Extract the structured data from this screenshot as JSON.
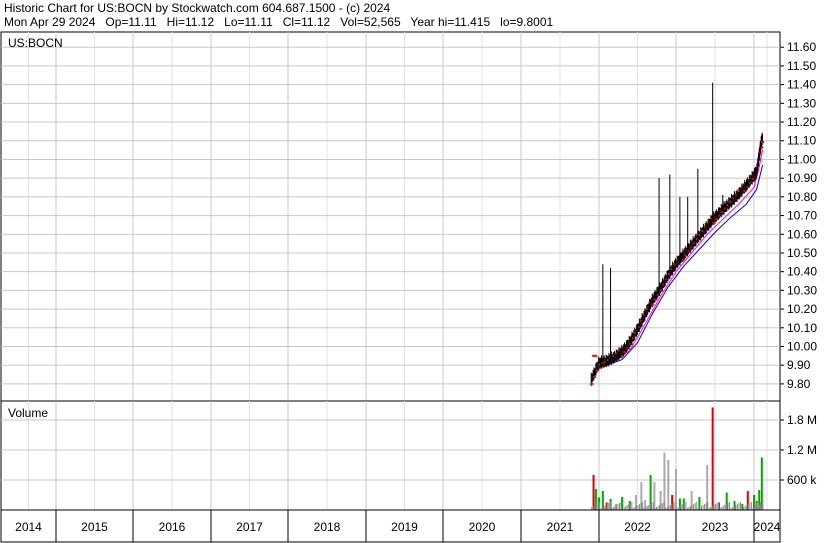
{
  "header": {
    "line1": "Historic Chart for US:BOCN by Stockwatch.com 604.687.1500 - (c) 2024",
    "line2": "Mon Apr 29 2024   Op=11.11   Hi=11.12   Lo=11.11   Cl=11.12   Vol=52,565   Year hi=11.415   lo=9.8001"
  },
  "chart_data": [
    {
      "type": "line",
      "title": "US:BOCN",
      "ylim": [
        9.73,
        11.66
      ],
      "ytick_labels": [
        "11.60",
        "11.50",
        "11.40",
        "11.30",
        "11.20",
        "11.10",
        "11.00",
        "10.90",
        "10.80",
        "10.70",
        "10.60",
        "10.50",
        "10.40",
        "10.30",
        "10.20",
        "10.10",
        "10.00",
        "9.90",
        "9.80"
      ],
      "yticks": [
        11.6,
        11.5,
        11.4,
        11.3,
        11.2,
        11.1,
        11.0,
        10.9,
        10.8,
        10.7,
        10.6,
        10.5,
        10.4,
        10.3,
        10.2,
        10.1,
        10.0,
        9.9,
        9.8
      ],
      "x_axis_years": [
        "2014",
        "2015",
        "2016",
        "2017",
        "2018",
        "2019",
        "2020",
        "2021",
        "2022",
        "2023",
        "2024"
      ],
      "grid": true,
      "series": [
        {
          "role": "price",
          "color": "#000000",
          "x": [
            2021.9,
            2022.0,
            2022.1,
            2022.2,
            2022.3,
            2022.4,
            2022.5,
            2022.6,
            2022.7,
            2022.8,
            2022.9,
            2023.0,
            2023.1,
            2023.2,
            2023.3,
            2023.4,
            2023.5,
            2023.6,
            2023.7,
            2023.8,
            2023.9,
            2024.0,
            2024.1,
            2024.2,
            2024.27,
            2024.33
          ],
          "y": [
            9.82,
            9.91,
            9.92,
            9.94,
            9.97,
            10.02,
            10.09,
            10.17,
            10.25,
            10.31,
            10.38,
            10.44,
            10.49,
            10.54,
            10.59,
            10.64,
            10.69,
            10.73,
            10.77,
            10.81,
            10.86,
            10.91,
            10.93,
            11.02,
            11.08,
            11.12
          ]
        },
        {
          "role": "high-spikes",
          "color": "#000000",
          "points": [
            [
              2022.05,
              10.44
            ],
            [
              2022.15,
              10.42
            ],
            [
              2022.5,
              10.12
            ],
            [
              2022.78,
              10.9
            ],
            [
              2022.92,
              10.92
            ],
            [
              2023.05,
              10.8
            ],
            [
              2023.15,
              10.8
            ],
            [
              2023.28,
              10.95
            ],
            [
              2023.47,
              11.41
            ],
            [
              2023.6,
              10.81
            ],
            [
              2023.75,
              10.83
            ],
            [
              2024.05,
              10.96
            ],
            [
              2024.25,
              11.07
            ]
          ]
        },
        {
          "role": "moving-average-short",
          "color": "#ff00ff",
          "x": [
            2022.0,
            2022.2,
            2022.4,
            2022.6,
            2022.8,
            2023.0,
            2023.2,
            2023.4,
            2023.6,
            2023.8,
            2024.0,
            2024.2,
            2024.33
          ],
          "y": [
            9.88,
            9.92,
            9.98,
            10.12,
            10.27,
            10.4,
            10.5,
            10.6,
            10.68,
            10.76,
            10.85,
            10.96,
            11.05
          ]
        },
        {
          "role": "moving-average-long",
          "color": "#0000cc",
          "x": [
            2022.1,
            2022.3,
            2022.5,
            2022.7,
            2022.9,
            2023.1,
            2023.3,
            2023.5,
            2023.7,
            2023.9,
            2024.1,
            2024.33
          ],
          "y": [
            9.9,
            9.93,
            10.02,
            10.18,
            10.32,
            10.43,
            10.52,
            10.61,
            10.69,
            10.76,
            10.84,
            10.97
          ]
        }
      ]
    },
    {
      "type": "bar",
      "title": "Volume",
      "ylim": [
        0,
        2100000
      ],
      "ytick_labels": [
        "1.8 M",
        "1.2 M",
        "600 k"
      ],
      "yticks": [
        1800000,
        1200000,
        600000
      ],
      "grid": true,
      "colors": {
        "up": "#00aa00",
        "down": "#dd0000",
        "flat": "#aaaaaa"
      },
      "bars": [
        {
          "x": 2021.93,
          "v": 700000,
          "c": "down"
        },
        {
          "x": 2021.96,
          "v": 420000,
          "c": "up"
        },
        {
          "x": 2022.0,
          "v": 250000,
          "c": "up"
        },
        {
          "x": 2022.05,
          "v": 380000,
          "c": "up"
        },
        {
          "x": 2022.1,
          "v": 150000,
          "c": "down"
        },
        {
          "x": 2022.15,
          "v": 220000,
          "c": "up"
        },
        {
          "x": 2022.22,
          "v": 120000,
          "c": "flat"
        },
        {
          "x": 2022.3,
          "v": 260000,
          "c": "up"
        },
        {
          "x": 2022.4,
          "v": 180000,
          "c": "up"
        },
        {
          "x": 2022.48,
          "v": 300000,
          "c": "flat"
        },
        {
          "x": 2022.55,
          "v": 560000,
          "c": "flat"
        },
        {
          "x": 2022.6,
          "v": 200000,
          "c": "flat"
        },
        {
          "x": 2022.67,
          "v": 700000,
          "c": "up"
        },
        {
          "x": 2022.72,
          "v": 560000,
          "c": "flat"
        },
        {
          "x": 2022.8,
          "v": 380000,
          "c": "flat"
        },
        {
          "x": 2022.85,
          "v": 1150000,
          "c": "flat"
        },
        {
          "x": 2022.9,
          "v": 1000000,
          "c": "flat"
        },
        {
          "x": 2022.95,
          "v": 300000,
          "c": "down"
        },
        {
          "x": 2023.0,
          "v": 820000,
          "c": "flat"
        },
        {
          "x": 2023.05,
          "v": 230000,
          "c": "up"
        },
        {
          "x": 2023.1,
          "v": 230000,
          "c": "up"
        },
        {
          "x": 2023.2,
          "v": 380000,
          "c": "flat"
        },
        {
          "x": 2023.3,
          "v": 260000,
          "c": "up"
        },
        {
          "x": 2023.4,
          "v": 900000,
          "c": "flat"
        },
        {
          "x": 2023.47,
          "v": 2050000,
          "c": "down"
        },
        {
          "x": 2023.55,
          "v": 150000,
          "c": "down"
        },
        {
          "x": 2023.65,
          "v": 350000,
          "c": "up"
        },
        {
          "x": 2023.75,
          "v": 180000,
          "c": "up"
        },
        {
          "x": 2023.85,
          "v": 120000,
          "c": "up"
        },
        {
          "x": 2023.92,
          "v": 380000,
          "c": "down"
        },
        {
          "x": 2024.0,
          "v": 300000,
          "c": "up"
        },
        {
          "x": 2024.1,
          "v": 180000,
          "c": "down"
        },
        {
          "x": 2024.2,
          "v": 400000,
          "c": "up"
        },
        {
          "x": 2024.3,
          "v": 1050000,
          "c": "up"
        }
      ]
    }
  ]
}
